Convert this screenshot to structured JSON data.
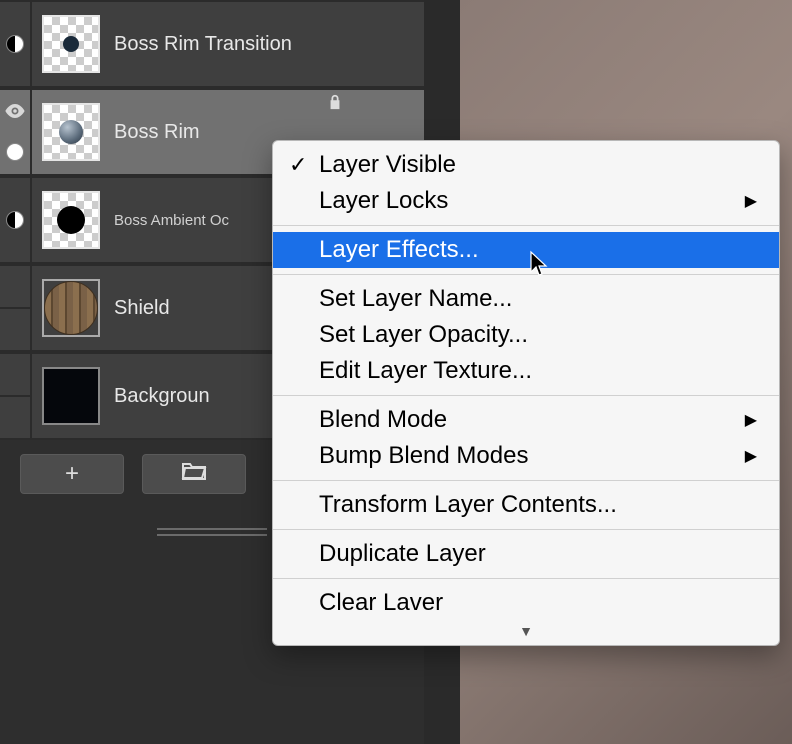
{
  "layers": [
    {
      "name": "Boss Rim Transition",
      "thumb": "dot",
      "small": false
    },
    {
      "name": "Boss Rim",
      "thumb": "sphere",
      "small": false,
      "selected": true,
      "visible": true,
      "locked": true
    },
    {
      "name": "Boss Ambient Oc",
      "thumb": "bigdot",
      "small": true
    },
    {
      "name": "Shield",
      "thumb": "wood",
      "small": false
    },
    {
      "name": "Backgroun",
      "thumb": "solid",
      "small": false
    }
  ],
  "context_menu": {
    "items": [
      {
        "label": "Layer Visible",
        "checked": true
      },
      {
        "label": "Layer Locks",
        "submenu": true
      },
      {
        "sep": true
      },
      {
        "label": "Layer Effects...",
        "selected": true
      },
      {
        "sep": true
      },
      {
        "label": "Set Layer Name..."
      },
      {
        "label": "Set Layer Opacity..."
      },
      {
        "label": "Edit Layer Texture..."
      },
      {
        "sep": true
      },
      {
        "label": "Blend Mode",
        "submenu": true
      },
      {
        "label": "Bump Blend Modes",
        "submenu": true
      },
      {
        "sep": true
      },
      {
        "label": "Transform Layer Contents..."
      },
      {
        "sep": true
      },
      {
        "label": "Duplicate Layer"
      },
      {
        "sep": true
      },
      {
        "label": "Clear Laver"
      }
    ]
  }
}
